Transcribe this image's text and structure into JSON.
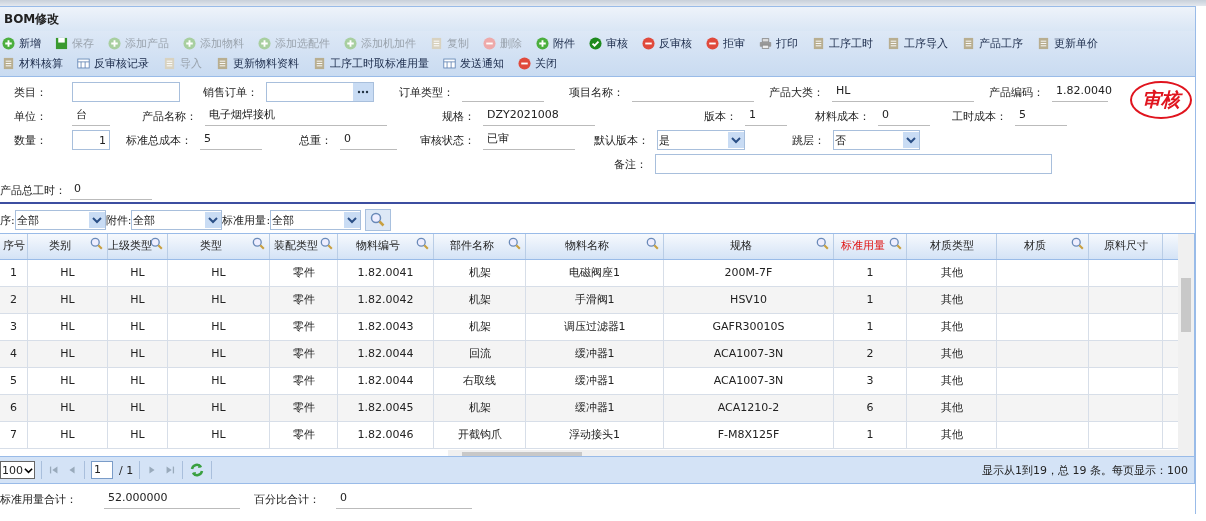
{
  "window": {
    "title": "BOM修改"
  },
  "toolbar": [
    [
      {
        "label": "新增",
        "kind": "add",
        "disabled": false
      },
      {
        "label": "保存",
        "kind": "save",
        "disabled": true
      },
      {
        "label": "添加产品",
        "kind": "add",
        "disabled": true
      },
      {
        "label": "添加物料",
        "kind": "add",
        "disabled": true
      },
      {
        "label": "添加选配件",
        "kind": "add",
        "disabled": true
      },
      {
        "label": "添加机加件",
        "kind": "add",
        "disabled": true
      },
      {
        "label": "复制",
        "kind": "doc",
        "disabled": true
      },
      {
        "label": "删除",
        "kind": "remove",
        "disabled": true
      },
      {
        "label": "附件",
        "kind": "add",
        "disabled": false
      },
      {
        "label": "审核",
        "kind": "check",
        "disabled": false
      },
      {
        "label": "反审核",
        "kind": "remove",
        "disabled": false
      },
      {
        "label": "拒审",
        "kind": "remove",
        "disabled": false
      },
      {
        "label": "打印",
        "kind": "print",
        "disabled": false
      },
      {
        "label": "工序工时",
        "kind": "doc",
        "disabled": false
      },
      {
        "label": "工序导入",
        "kind": "doc",
        "disabled": false
      },
      {
        "label": "产品工序",
        "kind": "doc",
        "disabled": false
      },
      {
        "label": "更新单价",
        "kind": "doc",
        "disabled": false
      }
    ],
    [
      {
        "label": "材料核算",
        "kind": "doc",
        "disabled": false
      },
      {
        "label": "反审核记录",
        "kind": "grid",
        "disabled": false
      },
      {
        "label": "导入",
        "kind": "doc",
        "disabled": true
      },
      {
        "label": "更新物料资料",
        "kind": "doc",
        "disabled": false
      },
      {
        "label": "工序工时取标准用量",
        "kind": "doc",
        "disabled": false
      },
      {
        "label": "发送通知",
        "kind": "grid",
        "disabled": false
      },
      {
        "label": "关闭",
        "kind": "remove",
        "disabled": false
      }
    ]
  ],
  "form": [
    [
      {
        "label": "类目：",
        "kind": "input"
      },
      {
        "label": "销售订单：",
        "kind": "lookup"
      },
      {
        "label": "订单类型：",
        "kind": "text"
      },
      {
        "label": "项目名称：",
        "kind": "text"
      },
      {
        "label": "产品大类：",
        "kind": "text",
        "value": "HL"
      },
      {
        "label": "产品编码：",
        "kind": "text",
        "value": "1.82.0040"
      }
    ],
    [
      {
        "label": "单位：",
        "kind": "text",
        "value": "台"
      },
      {
        "label": "产品名称：",
        "kind": "text",
        "value": "电子烟焊接机"
      },
      {
        "label": "规格：",
        "kind": "text",
        "value": "DZY2021008"
      },
      {
        "label": "版本：",
        "kind": "text",
        "value": "1"
      },
      {
        "label": "材料成本：",
        "kind": "text",
        "value": "0"
      },
      {
        "label": "工时成本：",
        "kind": "text",
        "value": "5"
      }
    ],
    [
      {
        "label": "数量：",
        "kind": "number",
        "value": "1"
      },
      {
        "label": "标准总成本：",
        "kind": "text",
        "value": "5"
      },
      {
        "label": "总重：",
        "kind": "text",
        "value": "0"
      },
      {
        "label": "审核状态：",
        "kind": "text",
        "value": "已审"
      },
      {
        "label": "默认版本：",
        "kind": "select",
        "value": "是"
      },
      {
        "label": "跳层：",
        "kind": "select",
        "value": "否"
      }
    ],
    [
      {
        "label": "备注：",
        "kind": "input"
      }
    ],
    [
      {
        "label": "产品总工时：",
        "kind": "text",
        "value": "0"
      }
    ]
  ],
  "stamp": "审核",
  "filters": [
    {
      "label": "序:",
      "value": "全部"
    },
    {
      "label": "附件:",
      "value": "全部"
    },
    {
      "label": "标准用量:",
      "value": "全部"
    }
  ],
  "table": {
    "columns": [
      {
        "label": "序号",
        "searchable": false,
        "highlight": false
      },
      {
        "label": "类别",
        "searchable": true,
        "highlight": false
      },
      {
        "label": "上级类型",
        "searchable": true,
        "highlight": false
      },
      {
        "label": "类型",
        "searchable": true,
        "highlight": false
      },
      {
        "label": "装配类型",
        "searchable": true,
        "highlight": false
      },
      {
        "label": "物料编号",
        "searchable": true,
        "highlight": false
      },
      {
        "label": "部件名称",
        "searchable": true,
        "highlight": false
      },
      {
        "label": "物料名称",
        "searchable": true,
        "highlight": false
      },
      {
        "label": "规格",
        "searchable": true,
        "highlight": false
      },
      {
        "label": "标准用量",
        "searchable": true,
        "highlight": true
      },
      {
        "label": "材质类型",
        "searchable": false,
        "highlight": false
      },
      {
        "label": "材质",
        "searchable": true,
        "highlight": false
      },
      {
        "label": "原料尺寸",
        "searchable": false,
        "highlight": false
      }
    ],
    "rows": [
      [
        "1",
        "HL",
        "HL",
        "HL",
        "零件",
        "1.82.0041",
        "机架",
        "电磁阀座1",
        "200M-7F",
        "1",
        "其他",
        "",
        ""
      ],
      [
        "2",
        "HL",
        "HL",
        "HL",
        "零件",
        "1.82.0042",
        "机架",
        "手滑阀1",
        "HSV10",
        "1",
        "其他",
        "",
        ""
      ],
      [
        "3",
        "HL",
        "HL",
        "HL",
        "零件",
        "1.82.0043",
        "机架",
        "调压过滤器1",
        "GAFR30010S",
        "1",
        "其他",
        "",
        ""
      ],
      [
        "4",
        "HL",
        "HL",
        "HL",
        "零件",
        "1.82.0044",
        "回流",
        "缓冲器1",
        "ACA1007-3N",
        "2",
        "其他",
        "",
        ""
      ],
      [
        "5",
        "HL",
        "HL",
        "HL",
        "零件",
        "1.82.0044",
        "右取线",
        "缓冲器1",
        "ACA1007-3N",
        "3",
        "其他",
        "",
        ""
      ],
      [
        "6",
        "HL",
        "HL",
        "HL",
        "零件",
        "1.82.0045",
        "机架",
        "缓冲器1",
        "ACA1210-2",
        "6",
        "其他",
        "",
        ""
      ],
      [
        "7",
        "HL",
        "HL",
        "HL",
        "零件",
        "1.82.0046",
        "开截钩爪",
        "浮动接头1",
        "F-M8X125F",
        "1",
        "其他",
        "",
        ""
      ]
    ]
  },
  "pager": {
    "page_size": "100",
    "page": "1",
    "total_pages": "/ 1",
    "summary": "显示从1到19，总 19 条。每页显示：100"
  },
  "totals": [
    {
      "label": "标准用量合计：",
      "value": "52.000000"
    },
    {
      "label": "百分比合计：",
      "value": "0"
    }
  ]
}
